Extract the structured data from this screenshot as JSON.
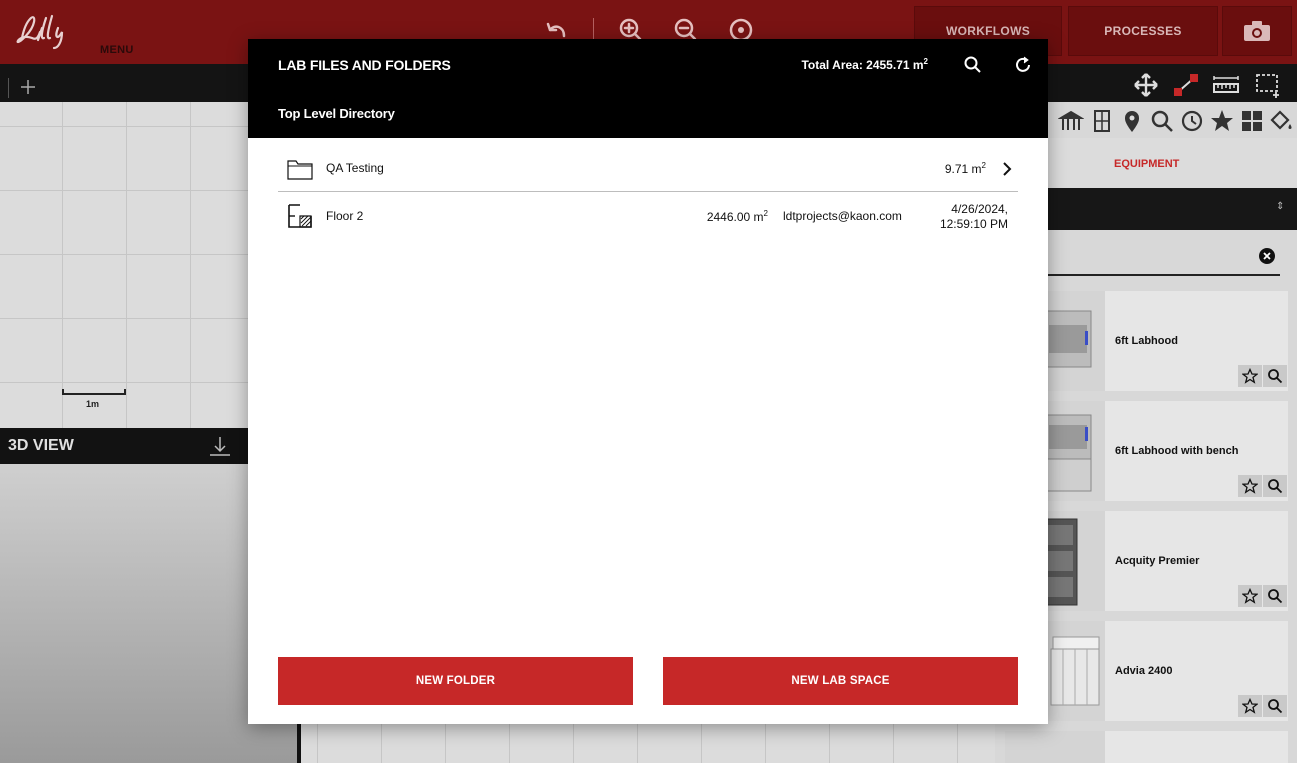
{
  "app": {
    "menu_label": "MENU",
    "top_buttons": {
      "workflows": "WORKFLOWS",
      "processes": "PROCESSES"
    }
  },
  "workspace": {
    "scale_label": "1m",
    "view3d_label": "3D VIEW"
  },
  "right_panel": {
    "active_tab": "EQUIPMENT",
    "equipment": [
      {
        "name": "6ft Labhood"
      },
      {
        "name": "6ft Labhood with bench"
      },
      {
        "name": "Acquity Premier"
      },
      {
        "name": "Advia 2400"
      }
    ]
  },
  "modal": {
    "title": "LAB FILES AND FOLDERS",
    "total_area_label": "Total Area: 2455.71 m",
    "total_area_unit_sup": "2",
    "directory": "Top Level Directory",
    "rows": [
      {
        "type": "folder",
        "name": "QA Testing",
        "size": "9.71 m",
        "size_sup": "2"
      },
      {
        "type": "lab-space",
        "name": "Floor 2",
        "size": "2446.00 m",
        "size_sup": "2",
        "owner": "ldtprojects@kaon.com",
        "date_line1": "4/26/2024,",
        "date_line2": "12:59:10 PM"
      }
    ],
    "buttons": {
      "new_folder": "NEW FOLDER",
      "new_lab_space": "NEW LAB SPACE"
    }
  },
  "colors": {
    "brand_red": "#c62828",
    "topbar": "#7a1313",
    "header_black": "#000000"
  }
}
